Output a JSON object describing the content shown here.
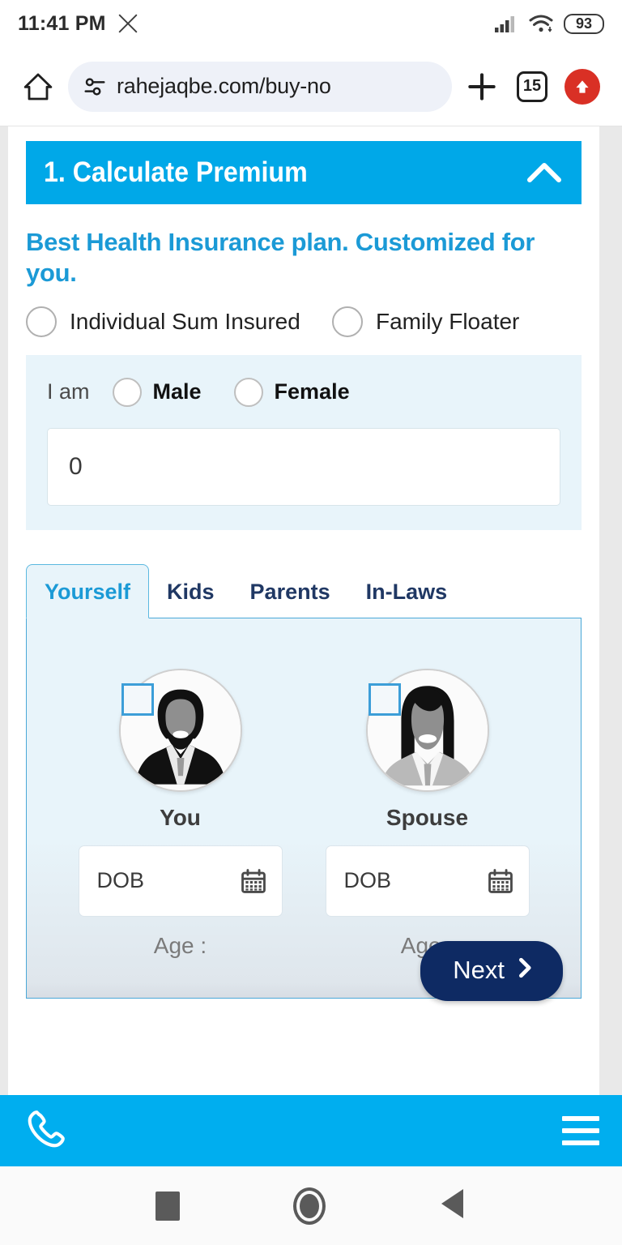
{
  "status_bar": {
    "time": "11:41 PM",
    "app_icon": "x-logo-icon",
    "signal_icon": "cellular-signal-icon",
    "wifi_icon": "wifi-icon",
    "battery_level": "93"
  },
  "browser": {
    "home_icon": "home-icon",
    "site_settings_icon": "site-settings-tune-icon",
    "url": "rahejaqbe.com/buy-no",
    "new_tab_icon": "plus-icon",
    "tab_count": "15",
    "update_icon": "update-arrow-up-icon"
  },
  "accordion": {
    "title": "1. Calculate Premium",
    "toggle_icon": "chevron-up-icon"
  },
  "headline": "Best Health Insurance plan. Customized for you.",
  "plan_options": [
    {
      "label": "Individual Sum Insured",
      "selected": false
    },
    {
      "label": "Family Floater",
      "selected": false
    }
  ],
  "gender": {
    "prefix": "I am",
    "options": [
      {
        "label": "Male",
        "selected": false
      },
      {
        "label": "Female",
        "selected": false
      }
    ],
    "sum_insured_value": "0"
  },
  "tabs": [
    {
      "label": "Yourself",
      "active": true
    },
    {
      "label": "Kids",
      "active": false
    },
    {
      "label": "Parents",
      "active": false
    },
    {
      "label": "In-Laws",
      "active": false
    }
  ],
  "members": [
    {
      "name": "You",
      "avatar_icon": "male-avatar-icon",
      "checkbox_checked": false,
      "dob_placeholder": "DOB",
      "calendar_icon": "calendar-icon",
      "age_label": "Age :"
    },
    {
      "name": "Spouse",
      "avatar_icon": "female-avatar-icon",
      "checkbox_checked": false,
      "dob_placeholder": "DOB",
      "calendar_icon": "calendar-icon",
      "age_label": "Age :"
    }
  ],
  "next_button": {
    "label": "Next",
    "icon": "chevron-right-icon"
  },
  "sticky_bar": {
    "phone_icon": "phone-icon",
    "menu_icon": "hamburger-menu-icon"
  },
  "android_nav": {
    "recents_icon": "square-recents-icon",
    "home_icon": "circle-home-icon",
    "back_icon": "triangle-back-icon"
  },
  "colors": {
    "accent_blue": "#00a8e8",
    "sticky_blue": "#00aeef",
    "headline_blue": "#1b9ad6",
    "tab_navy": "#203864",
    "next_navy": "#0e2a63",
    "panel_blue": "#e8f4fa",
    "checkbox_blue": "#3c9ed8",
    "update_red": "#d93025"
  }
}
